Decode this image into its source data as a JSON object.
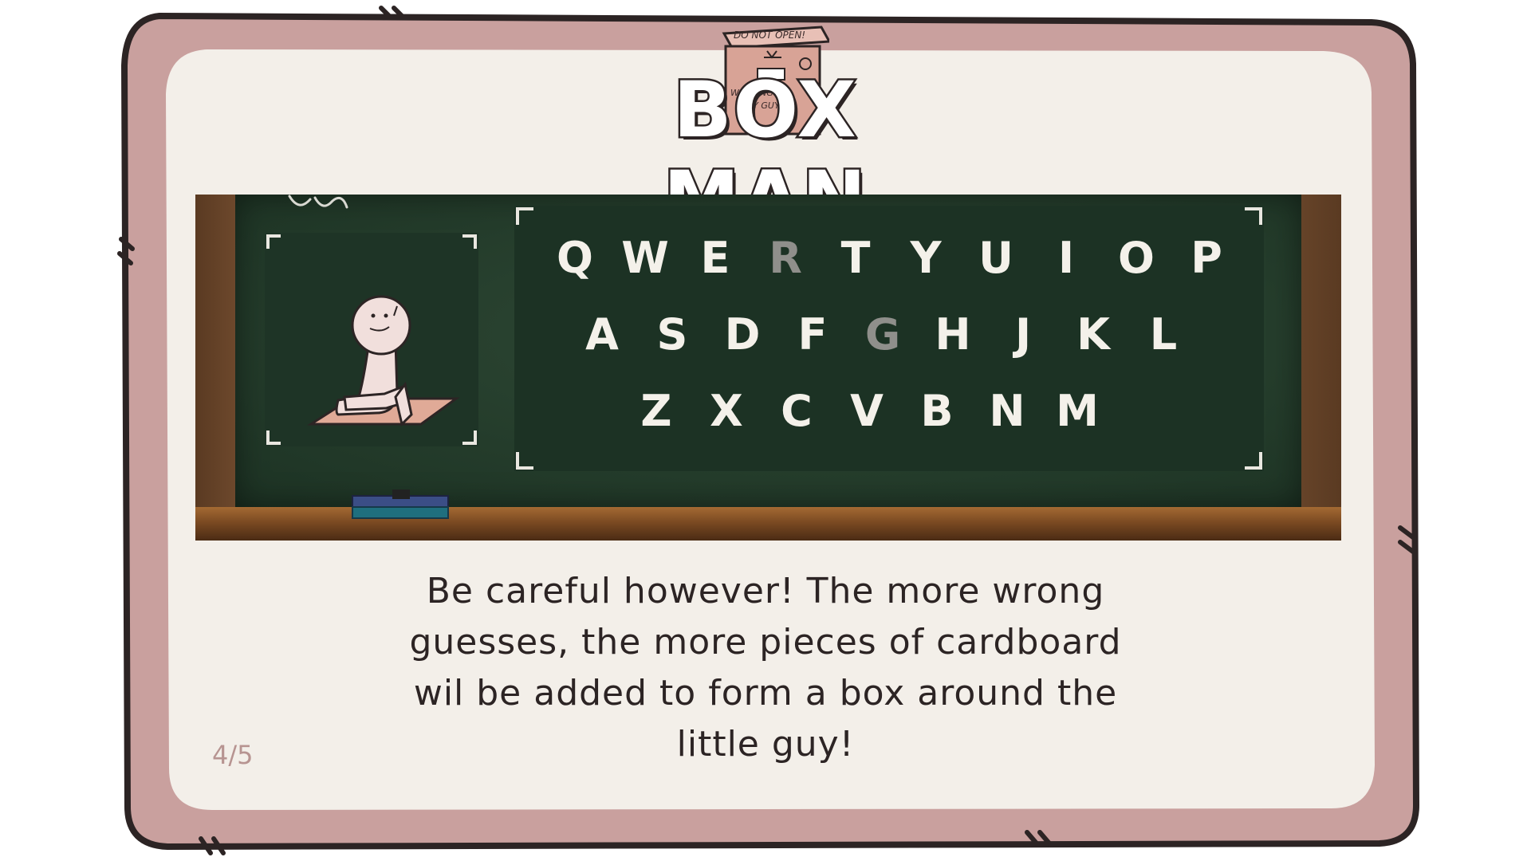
{
  "title": {
    "text": "BOX MAN",
    "logo": {
      "line1": "DO NOT OPEN!",
      "line2": "WARNING",
      "line3": "TINY GUY"
    }
  },
  "keyboard": {
    "rows": [
      [
        {
          "letter": "Q",
          "used": false
        },
        {
          "letter": "W",
          "used": false
        },
        {
          "letter": "E",
          "used": false
        },
        {
          "letter": "R",
          "used": true
        },
        {
          "letter": "T",
          "used": false
        },
        {
          "letter": "Y",
          "used": false
        },
        {
          "letter": "U",
          "used": false
        },
        {
          "letter": "I",
          "used": false
        },
        {
          "letter": "O",
          "used": false
        },
        {
          "letter": "P",
          "used": false
        }
      ],
      [
        {
          "letter": "A",
          "used": false
        },
        {
          "letter": "S",
          "used": false
        },
        {
          "letter": "D",
          "used": false
        },
        {
          "letter": "F",
          "used": false
        },
        {
          "letter": "G",
          "used": true
        },
        {
          "letter": "H",
          "used": false
        },
        {
          "letter": "J",
          "used": false
        },
        {
          "letter": "K",
          "used": false
        },
        {
          "letter": "L",
          "used": false
        }
      ],
      [
        {
          "letter": "Z",
          "used": false
        },
        {
          "letter": "X",
          "used": false
        },
        {
          "letter": "C",
          "used": false
        },
        {
          "letter": "V",
          "used": false
        },
        {
          "letter": "B",
          "used": false
        },
        {
          "letter": "N",
          "used": false
        },
        {
          "letter": "M",
          "used": false
        }
      ]
    ]
  },
  "instruction": {
    "lines": [
      "Be careful however! The more wrong",
      "guesses, the more pieces of cardboard",
      "wil be added to form a box around the",
      "little guy!"
    ]
  },
  "page_counter": "4/5",
  "colors": {
    "frame_outer": "#c9a09e",
    "frame_inner": "#f3efe9",
    "outline": "#2c2424",
    "chalk": "#f4f1ea",
    "chalk_used": "#8f8f8b",
    "board": "#243c2b"
  },
  "icons": {
    "character": "little-guy-icon",
    "logo": "cardboard-box-icon",
    "eraser": "chalk-eraser-icon"
  }
}
